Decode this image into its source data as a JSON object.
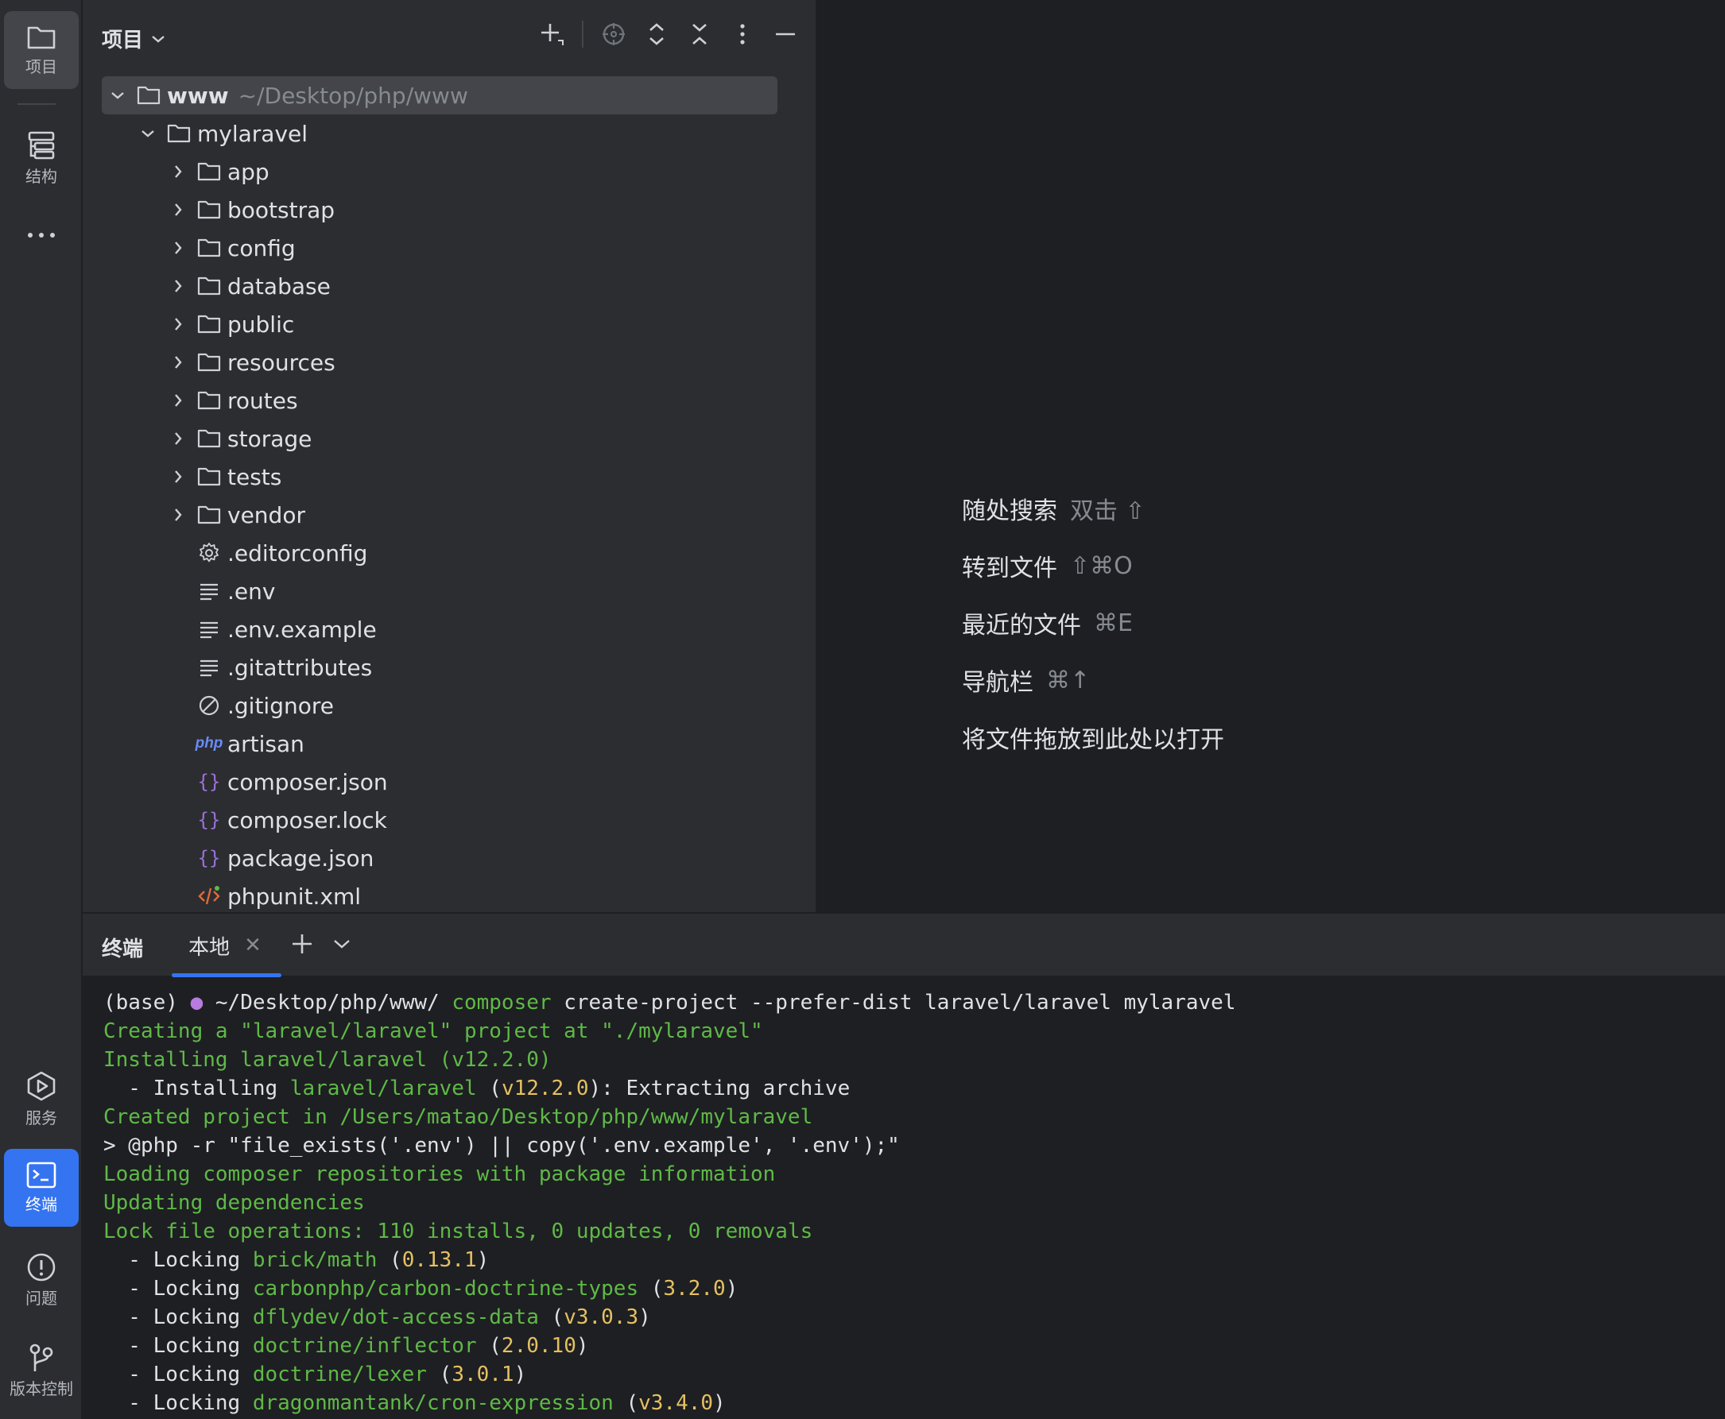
{
  "toolstrip": {
    "project_label": "项目",
    "structure_label": "结构",
    "services_label": "服务",
    "terminal_label": "终端",
    "problems_label": "问题",
    "vcs_label": "版本控制"
  },
  "project_panel": {
    "title": "项目"
  },
  "tree": {
    "root": {
      "name": "www",
      "path": "~/Desktop/php/www"
    },
    "project": {
      "name": "mylaravel"
    },
    "folders": [
      "app",
      "bootstrap",
      "config",
      "database",
      "public",
      "resources",
      "routes",
      "storage",
      "tests",
      "vendor"
    ],
    "files": [
      {
        "name": ".editorconfig",
        "icon": "gear-icon"
      },
      {
        "name": ".env",
        "icon": "text-file-icon"
      },
      {
        "name": ".env.example",
        "icon": "text-file-icon"
      },
      {
        "name": ".gitattributes",
        "icon": "text-file-icon"
      },
      {
        "name": ".gitignore",
        "icon": "ignore-file-icon"
      },
      {
        "name": "artisan",
        "icon": "php-file-icon",
        "badge": "php"
      },
      {
        "name": "composer.json",
        "icon": "json-file-icon"
      },
      {
        "name": "composer.lock",
        "icon": "json-file-icon"
      },
      {
        "name": "package.json",
        "icon": "json-file-icon"
      },
      {
        "name": "phpunit.xml",
        "icon": "xml-file-icon"
      }
    ]
  },
  "editor_hints": [
    {
      "label": "随处搜索",
      "key": "双击 ⇧"
    },
    {
      "label": "转到文件",
      "key": "⇧⌘O"
    },
    {
      "label": "最近的文件",
      "key": "⌘E"
    },
    {
      "label": "导航栏",
      "key": "⌘↑"
    },
    {
      "label": "将文件拖放到此处以打开",
      "key": ""
    }
  ],
  "terminal": {
    "title": "终端",
    "tab_label": "本地",
    "lines": {
      "l1_prefix": "(base) ",
      "l1_path": " ~/Desktop/php/www/ ",
      "l1_cmd": "composer",
      "l1_args": " create-project --prefer-dist laravel/laravel mylaravel",
      "l2": "Creating a \"laravel/laravel\" project at \"./mylaravel\"",
      "l3": "Installing laravel/laravel (v12.2.0)",
      "l4_a": "  - Installing ",
      "l4_pkg": "laravel/laravel",
      "l4_b": " (",
      "l4_ver": "v12.2.0",
      "l4_c": "): Extracting archive",
      "l5": "Created project in /Users/matao/Desktop/php/www/mylaravel",
      "l6": "> @php -r \"file_exists('.env') || copy('.env.example', '.env');\"",
      "l7": "Loading composer repositories with package information",
      "l8": "Updating dependencies",
      "l9": "Lock file operations: 110 installs, 0 updates, 0 removals",
      "locks": [
        {
          "pkg": "brick/math",
          "ver": "0.13.1"
        },
        {
          "pkg": "carbonphp/carbon-doctrine-types",
          "ver": "3.2.0"
        },
        {
          "pkg": "dflydev/dot-access-data",
          "ver": "v3.0.3"
        },
        {
          "pkg": "doctrine/inflector",
          "ver": "2.0.10"
        },
        {
          "pkg": "doctrine/lexer",
          "ver": "3.0.1"
        },
        {
          "pkg": "dragonmantank/cron-expression",
          "ver": "v3.4.0"
        }
      ],
      "lock_prefix": "  - Locking "
    }
  },
  "colors": {
    "accent": "#3574f0",
    "panel_bg": "#2b2d30",
    "editor_bg": "#1e1f22",
    "terminal_green": "#5fb947",
    "terminal_yellow": "#e4c062",
    "json_icon": "#9c6fd9",
    "php_icon": "#6b8bf5",
    "xml_icon": "#e0693a"
  }
}
